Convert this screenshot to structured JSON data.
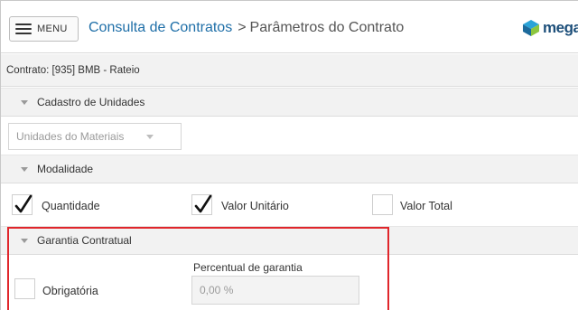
{
  "header": {
    "menu_label": "MENU",
    "breadcrumb_link": "Consulta de Contratos",
    "breadcrumb_separator": ">",
    "breadcrumb_current": "Parâmetros do Contrato",
    "logo_text": "mega"
  },
  "contract": {
    "label": "Contrato: [935] BMB - Rateio"
  },
  "sections": {
    "units": "Cadastro de Unidades",
    "modality": "Modalidade",
    "guarantee": "Garantia Contratual"
  },
  "units": {
    "select_value": "Unidades do Materiais"
  },
  "modality": {
    "options": [
      {
        "label": "Quantidade",
        "checked": true
      },
      {
        "label": "Valor Unitário",
        "checked": true
      },
      {
        "label": "Valor Total",
        "checked": false
      }
    ]
  },
  "guarantee": {
    "mandatory_label": "Obrigatória",
    "mandatory_checked": false,
    "percent_label": "Percentual de garantia",
    "percent_value": "0,00 %"
  },
  "colors": {
    "link": "#1f6fa8",
    "highlight": "#e0262b",
    "logo": "#1d4f7a"
  }
}
